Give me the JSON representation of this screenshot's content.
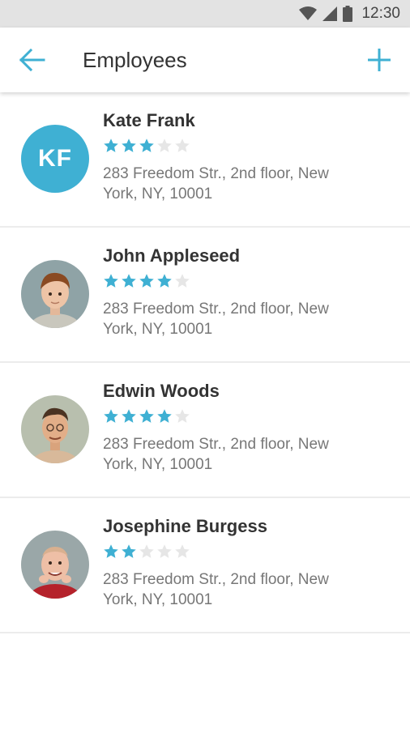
{
  "status_bar": {
    "time": "12:30"
  },
  "app_bar": {
    "title": "Employees"
  },
  "colors": {
    "accent": "#3fb0d3",
    "star_on": "#3fb0d3",
    "star_off": "#e6e6e6"
  },
  "employees": [
    {
      "name": "Kate Frank",
      "initials": "KF",
      "rating": 3,
      "max_rating": 5,
      "address": "283 Freedom Str., 2nd floor, New York, NY, 10001"
    },
    {
      "name": "John Appleseed",
      "rating": 4,
      "max_rating": 5,
      "address": "283 Freedom Str., 2nd floor, New York, NY, 10001"
    },
    {
      "name": "Edwin Woods",
      "rating": 4,
      "max_rating": 5,
      "address": "283 Freedom Str., 2nd floor, New York, NY, 10001"
    },
    {
      "name": "Josephine Burgess",
      "rating": 2,
      "max_rating": 5,
      "address": "283 Freedom Str., 2nd floor, New York, NY, 10001"
    }
  ]
}
